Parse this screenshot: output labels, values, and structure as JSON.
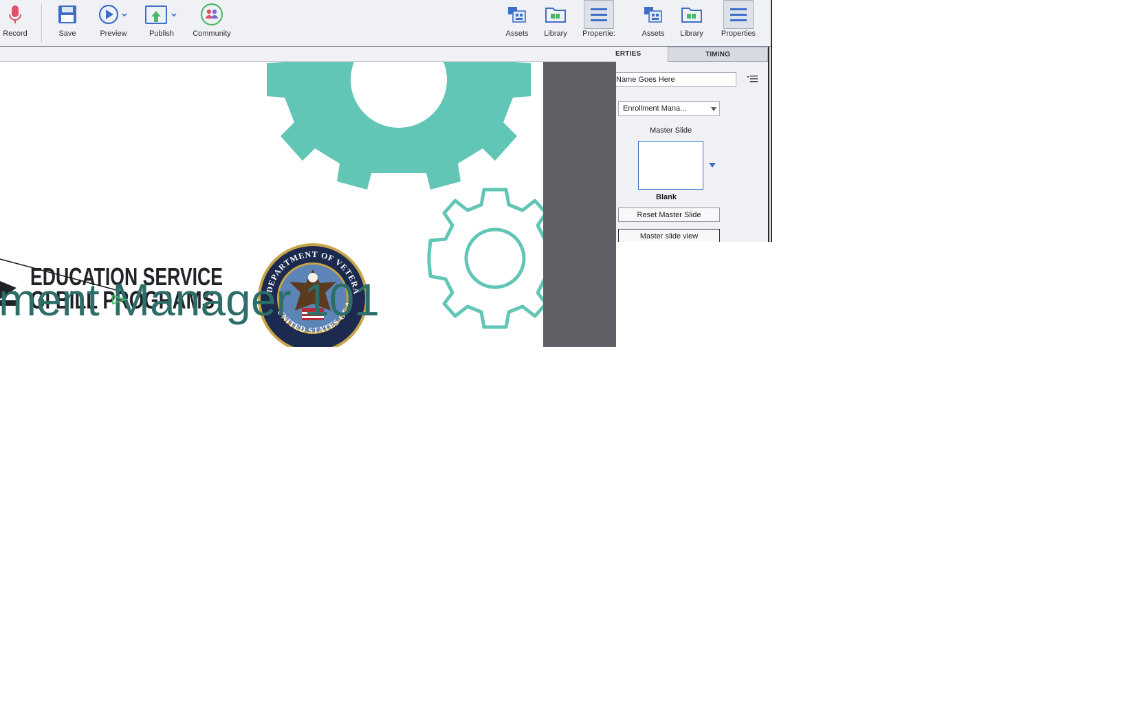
{
  "toolbar": {
    "left": [
      {
        "label": "Record",
        "icon": "microphone-icon"
      },
      {
        "label": "Save",
        "icon": "save-icon"
      },
      {
        "label": "Preview",
        "icon": "play-icon"
      },
      {
        "label": "Publish",
        "icon": "publish-icon"
      },
      {
        "label": "Community",
        "icon": "community-icon"
      }
    ],
    "right_group_1": [
      {
        "label": "Assets",
        "icon": "assets-icon"
      },
      {
        "label": "Library",
        "icon": "library-icon"
      },
      {
        "label": "Propertie:",
        "icon": "properties-icon"
      }
    ],
    "right_group_2": [
      {
        "label": "Assets",
        "icon": "assets-icon"
      },
      {
        "label": "Library",
        "icon": "library-icon"
      },
      {
        "label": "Properties",
        "icon": "properties-icon"
      }
    ]
  },
  "properties_panel": {
    "tabs": [
      "ERTIES",
      "TIMING"
    ],
    "slide_name_value": "Name Goes Here",
    "master_dropdown_value": "Enrollment Mana...",
    "master_slide_label": "Master Slide",
    "master_thumb_caption": "Blank",
    "reset_button": "Reset Master Slide",
    "view_button": "Master slide view"
  },
  "slide": {
    "title_text": "ment Manager 101",
    "logo_line1": "EDUCATION SERVICE",
    "logo_line2": "GI BILL PROGRAMS",
    "seal_text_top": "DEPARTMENT OF VETERANS AFFAIRS",
    "seal_text_bottom": "UNITED STATES OF AMERICA"
  },
  "colors": {
    "accent_teal": "#62c6b7",
    "title_teal": "#2d6e68",
    "icon_blue": "#3e6fc7",
    "record_red": "#e2506a"
  }
}
